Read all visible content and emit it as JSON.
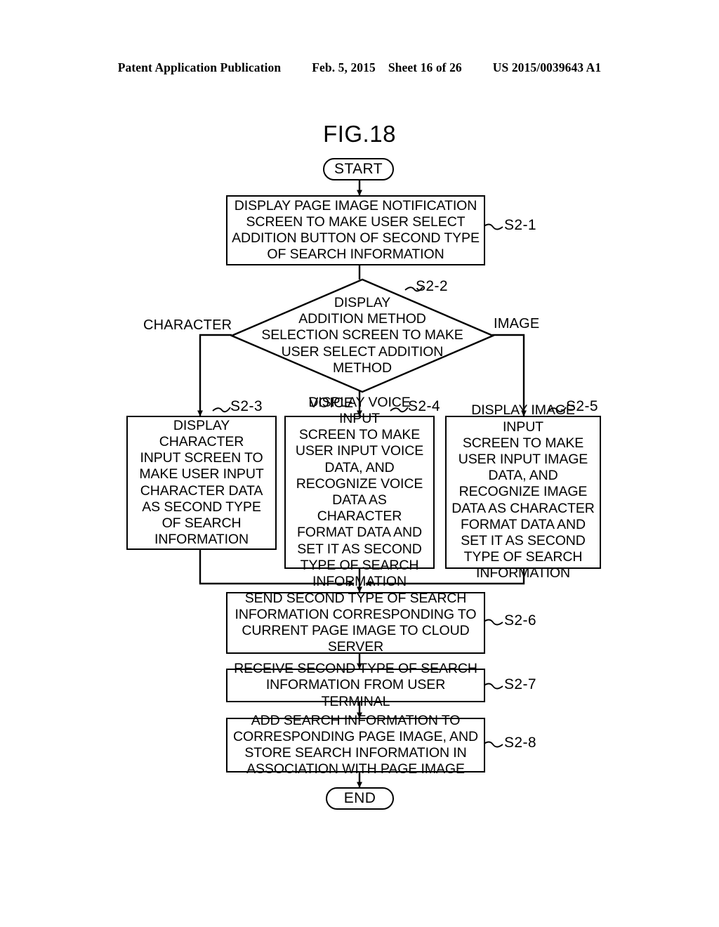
{
  "header": {
    "publication": "Patent Application Publication",
    "date": "Feb. 5, 2015",
    "sheet": "Sheet 16 of 26",
    "number": "US 2015/0039643 A1"
  },
  "figure": {
    "title": "FIG.18"
  },
  "nodes": {
    "start": {
      "label": "START"
    },
    "end": {
      "label": "END"
    },
    "s2_1": {
      "ref": "S2-1",
      "text": "DISPLAY PAGE IMAGE NOTIFICATION SCREEN TO MAKE USER SELECT ADDITION BUTTON OF SECOND TYPE OF SEARCH INFORMATION",
      "lines": [
        "DISPLAY PAGE IMAGE NOTIFICATION",
        "SCREEN TO MAKE USER SELECT",
        "ADDITION BUTTON OF SECOND TYPE",
        "OF SEARCH INFORMATION"
      ]
    },
    "s2_2": {
      "ref": "S2-2",
      "text": "DISPLAY ADDITION METHOD SELECTION SCREEN TO MAKE USER SELECT ADDITION METHOD",
      "lines": [
        "DISPLAY",
        "ADDITION METHOD",
        "SELECTION SCREEN TO MAKE",
        "USER SELECT ADDITION",
        "METHOD"
      ]
    },
    "s2_3": {
      "ref": "S2-3",
      "text": "DISPLAY CHARACTER INPUT SCREEN TO MAKE USER INPUT CHARACTER DATA AS SECOND TYPE OF SEARCH INFORMATION",
      "lines": [
        "DISPLAY",
        "CHARACTER",
        "INPUT SCREEN TO",
        "MAKE USER INPUT",
        "CHARACTER DATA",
        "AS SECOND TYPE",
        "OF SEARCH",
        "INFORMATION"
      ]
    },
    "s2_4": {
      "ref": "S2-4",
      "text": "DISPLAY VOICE INPUT SCREEN TO MAKE USER INPUT VOICE DATA, AND RECOGNIZE VOICE DATA AS CHARACTER FORMAT DATA AND SET IT AS SECOND TYPE OF SEARCH INFORMATION",
      "lines": [
        "DISPLAY VOICE INPUT",
        "SCREEN TO MAKE",
        "USER INPUT VOICE",
        "DATA, AND",
        "RECOGNIZE VOICE",
        "DATA AS CHARACTER",
        "FORMAT DATA AND",
        "SET IT AS SECOND",
        "TYPE OF SEARCH",
        "INFORMATION"
      ]
    },
    "s2_5": {
      "ref": "S2-5",
      "text": "DISPLAY IMAGE INPUT SCREEN TO MAKE USER INPUT IMAGE DATA, AND RECOGNIZE IMAGE DATA AS CHARACTER FORMAT DATA AND SET IT AS SECOND TYPE OF SEARCH INFORMATION",
      "lines": [
        "DISPLAY IMAGE INPUT",
        "SCREEN TO MAKE",
        "USER INPUT IMAGE",
        "DATA, AND",
        "RECOGNIZE IMAGE",
        "DATA AS CHARACTER",
        "FORMAT DATA AND",
        "SET IT AS SECOND",
        "TYPE OF SEARCH",
        "INFORMATION"
      ]
    },
    "s2_6": {
      "ref": "S2-6",
      "text": "SEND SECOND TYPE OF SEARCH INFORMATION CORRESPONDING TO CURRENT PAGE IMAGE TO CLOUD SERVER",
      "lines": [
        "SEND SECOND TYPE OF SEARCH",
        "INFORMATION CORRESPONDING TO",
        "CURRENT PAGE IMAGE TO CLOUD",
        "SERVER"
      ]
    },
    "s2_7": {
      "ref": "S2-7",
      "text": "RECEIVE SECOND TYPE OF SEARCH INFORMATION FROM USER TERMINAL",
      "lines": [
        "RECEIVE SECOND TYPE OF SEARCH",
        "INFORMATION FROM USER TERMINAL"
      ]
    },
    "s2_8": {
      "ref": "S2-8",
      "text": "ADD SEARCH INFORMATION TO CORRESPONDING PAGE IMAGE, AND STORE SEARCH INFORMATION IN ASSOCIATION WITH PAGE IMAGE",
      "lines": [
        "ADD SEARCH INFORMATION TO",
        "CORRESPONDING PAGE IMAGE, AND",
        "STORE SEARCH INFORMATION IN",
        "ASSOCIATION WITH PAGE IMAGE"
      ]
    }
  },
  "branches": {
    "character": "CHARACTER",
    "voice": "VOICE",
    "image": "IMAGE"
  },
  "colors": {
    "ink": "#000000",
    "paper": "#ffffff"
  }
}
